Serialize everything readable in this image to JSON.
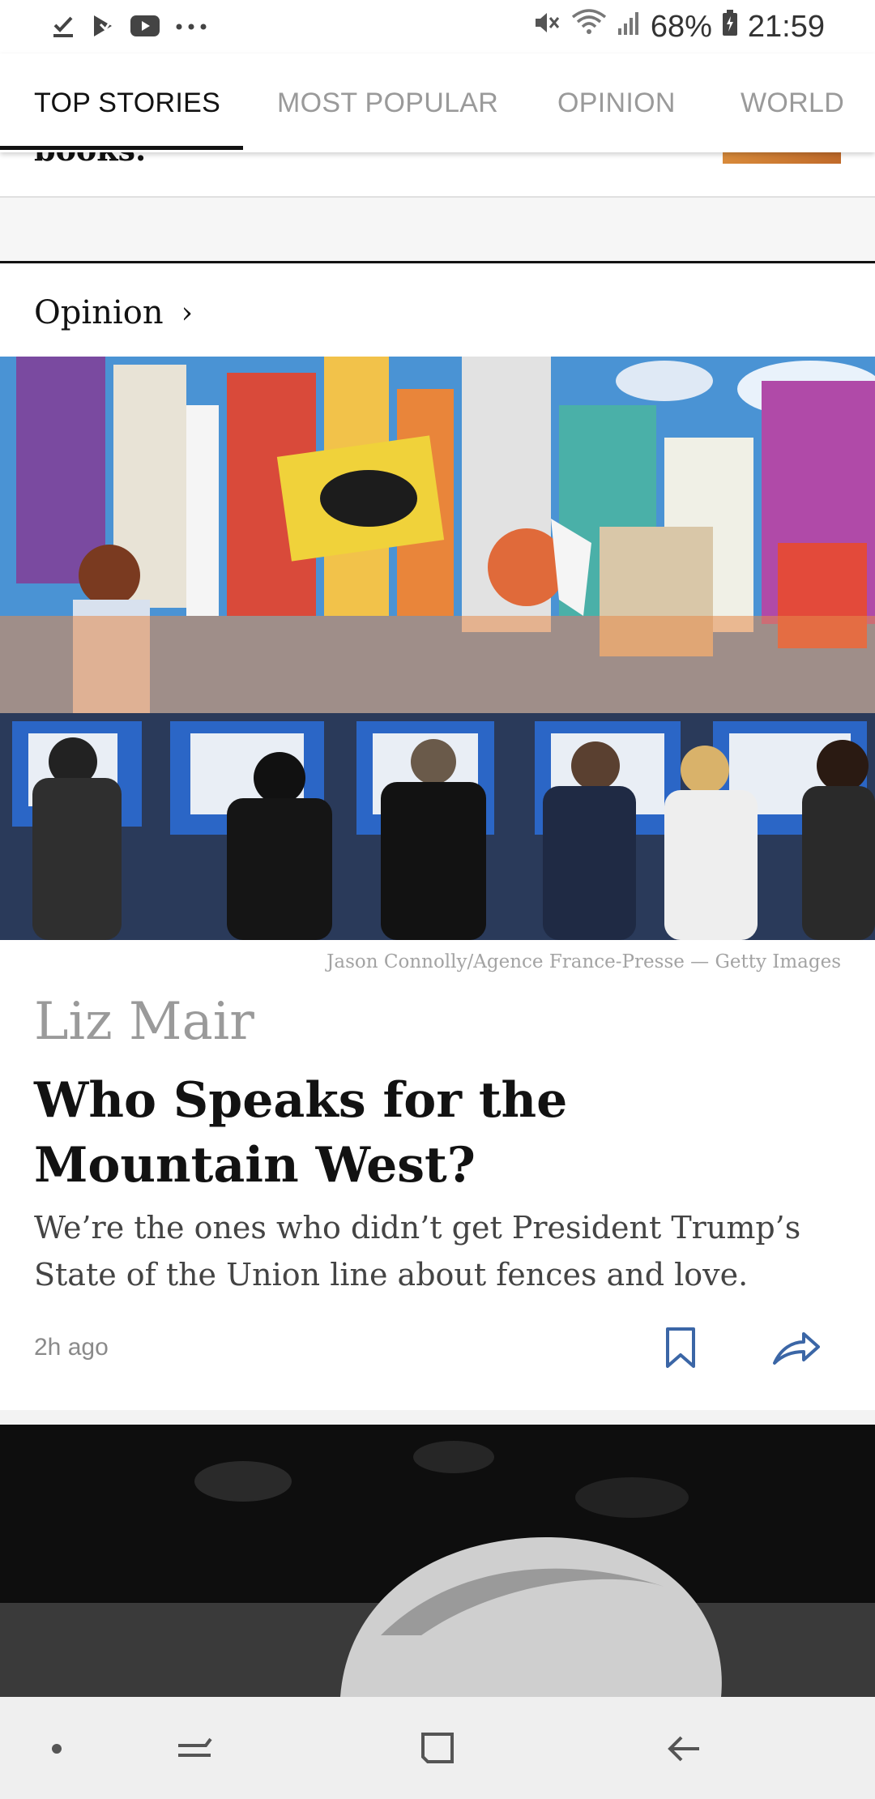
{
  "status_bar": {
    "left_icons": [
      "download-done-icon",
      "play-store-icon",
      "youtube-icon",
      "more-dots-icon"
    ],
    "right_icons": [
      "mute-icon",
      "wifi-icon",
      "signal-icon",
      "battery-icon"
    ],
    "battery": "68%",
    "time": "21:59"
  },
  "tabs": [
    {
      "label": "TOP STORIES",
      "active": true
    },
    {
      "label": "MOST POPULAR",
      "active": false
    },
    {
      "label": "OPINION",
      "active": false
    },
    {
      "label": "WORLD",
      "active": false
    }
  ],
  "prev_card": {
    "text": "books."
  },
  "section": {
    "title": "Opinion",
    "chevron": "›"
  },
  "article": {
    "photo_credit": "Jason Connolly/Agence France-Presse — Getty Images",
    "byline": "Liz Mair",
    "headline": "Who Speaks for the Mountain West?",
    "summary": "We’re the ones who didn’t get President Trump’s State of the Union line about fences and love.",
    "time": "2h ago"
  },
  "navbar": {
    "buttons": [
      "dot-icon",
      "recents-icon",
      "home-icon",
      "back-icon"
    ]
  }
}
